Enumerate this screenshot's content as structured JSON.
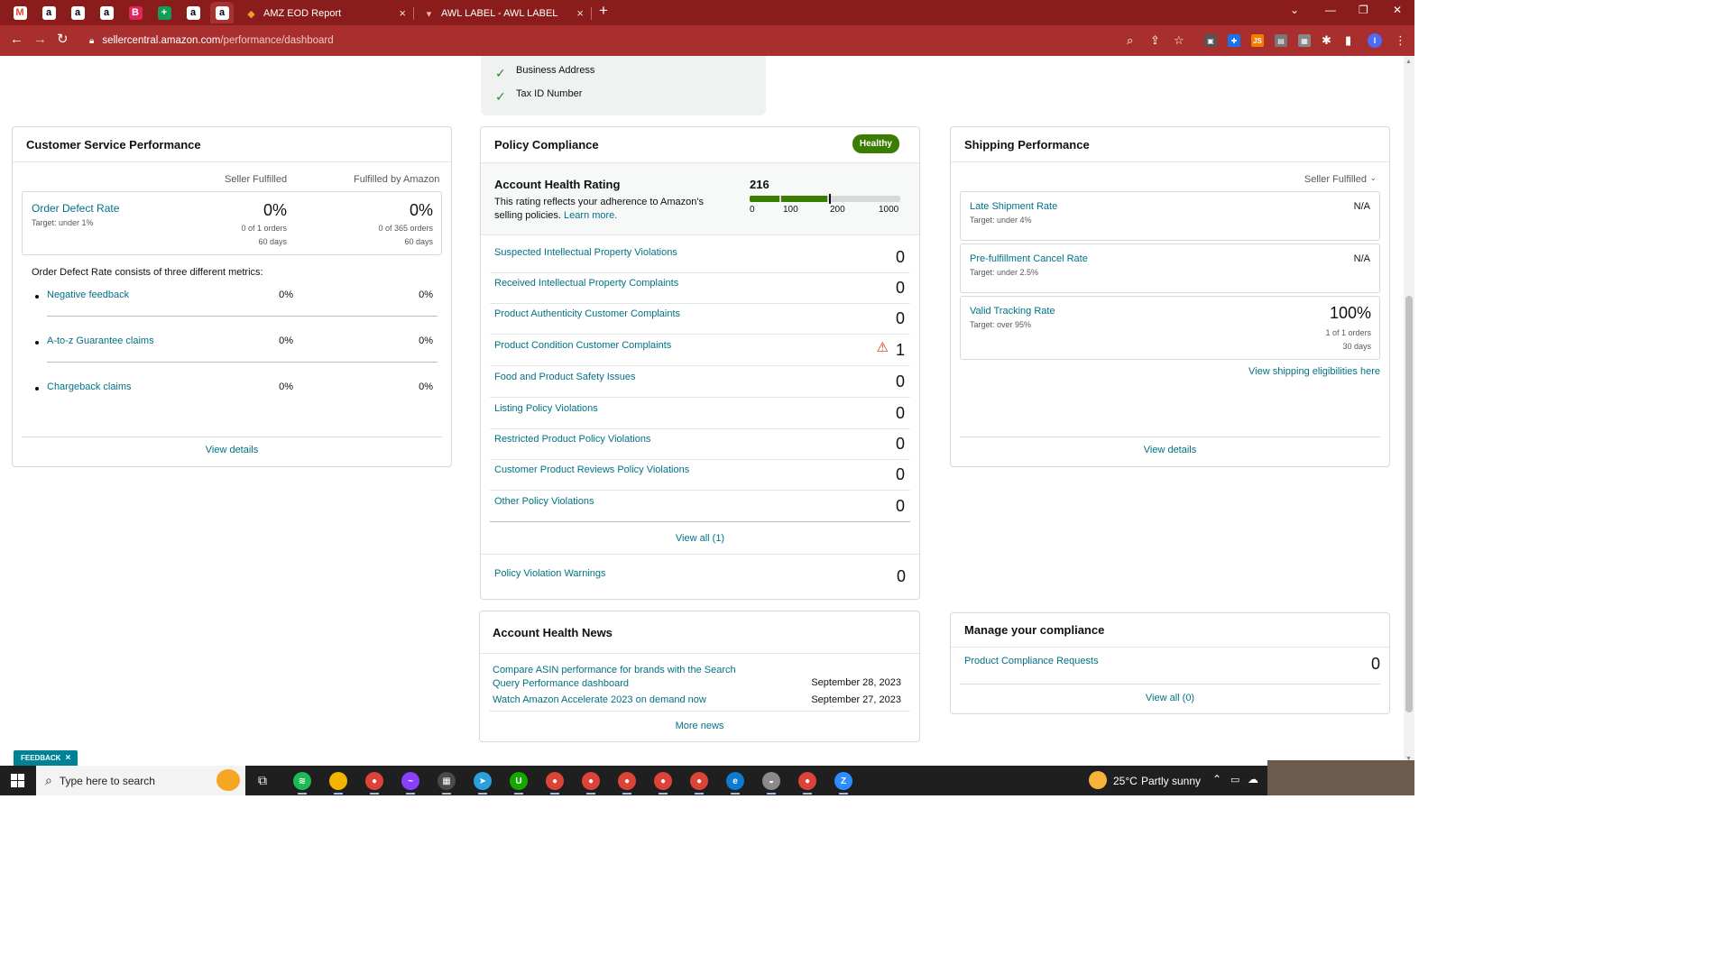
{
  "browser": {
    "pinned_tabs": [
      {
        "icon": "gmail-icon",
        "glyph": "M",
        "color": "#ea4335",
        "bg": "#ffffff"
      },
      {
        "icon": "amazon-icon",
        "glyph": "a",
        "color": "#000000",
        "bg": "#ffffff"
      },
      {
        "icon": "amazon-icon",
        "glyph": "a",
        "color": "#000000",
        "bg": "#ffffff"
      },
      {
        "icon": "amazon-icon",
        "glyph": "a",
        "color": "#000000",
        "bg": "#ffffff"
      },
      {
        "icon": "brand-b-icon",
        "glyph": "B",
        "color": "#ffffff",
        "bg": "#e0245e"
      },
      {
        "icon": "sheets-plus-icon",
        "glyph": "+",
        "color": "#ffffff",
        "bg": "#0f9d58"
      },
      {
        "icon": "amazon-icon",
        "glyph": "a",
        "color": "#000000",
        "bg": "#ffffff"
      },
      {
        "icon": "amazon-icon",
        "glyph": "a",
        "color": "#000000",
        "bg": "#ffffff"
      }
    ],
    "tabs": [
      {
        "title": "AMZ EOD Report",
        "close": "×"
      },
      {
        "title": "AWL LABEL - AWL LABEL",
        "close": "×"
      }
    ],
    "new_tab": "+",
    "url_host": "sellercentral.amazon.com",
    "url_path": "/performance/dashboard",
    "profile_initial": "I"
  },
  "top_card": {
    "items": [
      "Business Address",
      "Tax ID Number"
    ]
  },
  "customer_service": {
    "title": "Customer Service Performance",
    "col1": "Seller Fulfilled",
    "col2": "Fulfilled by Amazon",
    "odr": {
      "label": "Order Defect Rate",
      "target": "Target: under 1%",
      "sf_value": "0%",
      "sf_orders": "0 of 1 orders",
      "sf_days": "60 days",
      "fba_value": "0%",
      "fba_orders": "0 of 365 orders",
      "fba_days": "60 days"
    },
    "consists": "Order Defect Rate consists of three different metrics:",
    "metrics": [
      {
        "label": "Negative feedback",
        "sf": "0%",
        "fba": "0%"
      },
      {
        "label": "A-to-z Guarantee claims",
        "sf": "0%",
        "fba": "0%"
      },
      {
        "label": "Chargeback claims",
        "sf": "0%",
        "fba": "0%"
      }
    ],
    "view_details": "View details"
  },
  "policy": {
    "title": "Policy Compliance",
    "badge": "Healthy",
    "ahr_title": "Account Health Rating",
    "ahr_desc": "This rating reflects your adherence to Amazon's selling policies.",
    "learn_more": "Learn more.",
    "rating": "216",
    "scale": [
      "0",
      "100",
      "200",
      "1000"
    ],
    "rows": [
      {
        "label": "Suspected Intellectual Property Violations",
        "value": "0",
        "warn": false
      },
      {
        "label": "Received Intellectual Property Complaints",
        "value": "0",
        "warn": false
      },
      {
        "label": "Product Authenticity Customer Complaints",
        "value": "0",
        "warn": false
      },
      {
        "label": "Product Condition Customer Complaints",
        "value": "1",
        "warn": true
      },
      {
        "label": "Food and Product Safety Issues",
        "value": "0",
        "warn": false
      },
      {
        "label": "Listing Policy Violations",
        "value": "0",
        "warn": false
      },
      {
        "label": "Restricted Product Policy Violations",
        "value": "0",
        "warn": false
      },
      {
        "label": "Customer Product Reviews Policy Violations",
        "value": "0",
        "warn": false
      },
      {
        "label": "Other Policy Violations",
        "value": "0",
        "warn": false
      }
    ],
    "view_all": "View all (1)",
    "warnings_label": "Policy Violation Warnings",
    "warnings_value": "0"
  },
  "news": {
    "title": "Account Health News",
    "items": [
      {
        "text": "Compare ASIN performance for brands with the Search Query Performance dashboard",
        "date": "September 28, 2023"
      },
      {
        "text": "Watch Amazon Accelerate 2023 on demand now",
        "date": "September 27, 2023"
      }
    ],
    "more": "More news"
  },
  "shipping": {
    "title": "Shipping Performance",
    "dropdown": "Seller Fulfilled",
    "metrics": [
      {
        "label": "Late Shipment Rate",
        "target": "Target: under 4%",
        "value": "N/A"
      },
      {
        "label": "Pre-fulfillment Cancel Rate",
        "target": "Target: under 2.5%",
        "value": "N/A"
      }
    ],
    "tracking": {
      "label": "Valid Tracking Rate",
      "target": "Target: over 95%",
      "value": "100%",
      "orders": "1 of 1 orders",
      "days": "30 days"
    },
    "eligibility": "View shipping eligibilities here",
    "view_details": "View details"
  },
  "compliance": {
    "title": "Manage your compliance",
    "row_label": "Product Compliance Requests",
    "row_value": "0",
    "view_all": "View all (0)"
  },
  "feedback": "FEEDBACK",
  "feedback_close": "×",
  "taskbar": {
    "search_placeholder": "Type here to search",
    "weather_temp": "25°C",
    "weather_desc": "Partly sunny",
    "apps": [
      {
        "name": "spotify-icon",
        "color": "#1db954",
        "glyph": "≋"
      },
      {
        "name": "file-explorer-icon",
        "color": "#f4b400",
        "glyph": ""
      },
      {
        "name": "chrome-icon",
        "color": "#db4437",
        "glyph": "●"
      },
      {
        "name": "messenger-icon",
        "color": "#8a3ffc",
        "glyph": "~"
      },
      {
        "name": "calculator-icon",
        "color": "#4a4a4a",
        "glyph": "▦"
      },
      {
        "name": "telegram-icon",
        "color": "#2aa1da",
        "glyph": "➤"
      },
      {
        "name": "upwork-icon",
        "color": "#14a800",
        "glyph": "U"
      },
      {
        "name": "chrome-profile-icon",
        "color": "#db4437",
        "glyph": "●"
      },
      {
        "name": "chrome-profile-icon",
        "color": "#db4437",
        "glyph": "●"
      },
      {
        "name": "chrome-profile-icon",
        "color": "#db4437",
        "glyph": "●"
      },
      {
        "name": "chrome-profile-icon",
        "color": "#db4437",
        "glyph": "●"
      },
      {
        "name": "chrome-profile-icon",
        "color": "#db4437",
        "glyph": "●"
      },
      {
        "name": "edge-icon",
        "color": "#0c7bd0",
        "glyph": "e"
      },
      {
        "name": "game-icon",
        "color": "#8a8a8a",
        "glyph": "◒"
      },
      {
        "name": "chrome-icon",
        "color": "#db4437",
        "glyph": "●"
      },
      {
        "name": "zoom-icon",
        "color": "#2d8cff",
        "glyph": "Z"
      }
    ]
  },
  "colors": {
    "link": "#007185",
    "healthy": "#3a7d00",
    "warning": "#d13212",
    "chrome": "#8a1c1c"
  }
}
